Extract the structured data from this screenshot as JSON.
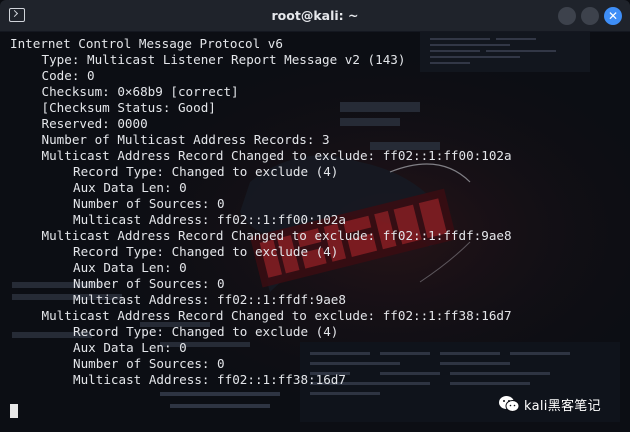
{
  "window": {
    "title": "root@kali: ~",
    "close_glyph": "✕"
  },
  "terminal": {
    "lines": [
      {
        "indent": 0,
        "text": "Internet Control Message Protocol v6"
      },
      {
        "indent": 1,
        "text": "Type: Multicast Listener Report Message v2 (143)"
      },
      {
        "indent": 1,
        "text": "Code: 0"
      },
      {
        "indent": 1,
        "text": "Checksum: 0×68b9 [correct]"
      },
      {
        "indent": 1,
        "text": "[Checksum Status: Good]"
      },
      {
        "indent": 1,
        "text": "Reserved: 0000"
      },
      {
        "indent": 1,
        "text": "Number of Multicast Address Records: 3"
      },
      {
        "indent": 1,
        "text": "Multicast Address Record Changed to exclude: ff02::1:ff00:102a"
      },
      {
        "indent": 2,
        "text": "Record Type: Changed to exclude (4)"
      },
      {
        "indent": 2,
        "text": "Aux Data Len: 0"
      },
      {
        "indent": 2,
        "text": "Number of Sources: 0"
      },
      {
        "indent": 2,
        "text": "Multicast Address: ff02::1:ff00:102a"
      },
      {
        "indent": 1,
        "text": "Multicast Address Record Changed to exclude: ff02::1:ffdf:9ae8"
      },
      {
        "indent": 2,
        "text": "Record Type: Changed to exclude (4)"
      },
      {
        "indent": 2,
        "text": "Aux Data Len: 0"
      },
      {
        "indent": 2,
        "text": "Number of Sources: 0"
      },
      {
        "indent": 2,
        "text": "Multicast Address: ff02::1:ffdf:9ae8"
      },
      {
        "indent": 1,
        "text": "Multicast Address Record Changed to exclude: ff02::1:ff38:16d7"
      },
      {
        "indent": 2,
        "text": "Record Type: Changed to exclude (4)"
      },
      {
        "indent": 2,
        "text": "Aux Data Len: 0"
      },
      {
        "indent": 2,
        "text": "Number of Sources: 0"
      },
      {
        "indent": 2,
        "text": "Multicast Address: ff02::1:ff38:16d7"
      }
    ]
  },
  "watermark": {
    "text": "kali黑客笔记",
    "icon": "wechat-icon"
  },
  "colors": {
    "background": "#0c0e14",
    "titlebar": "#1f232b",
    "text": "#e4e6ea",
    "close_button": "#3e8ef7",
    "accent_red": "#8a1d22"
  },
  "icons": {
    "terminal": "terminal-icon",
    "minimize": "minimize-icon",
    "maximize": "maximize-icon",
    "close": "close-icon"
  }
}
